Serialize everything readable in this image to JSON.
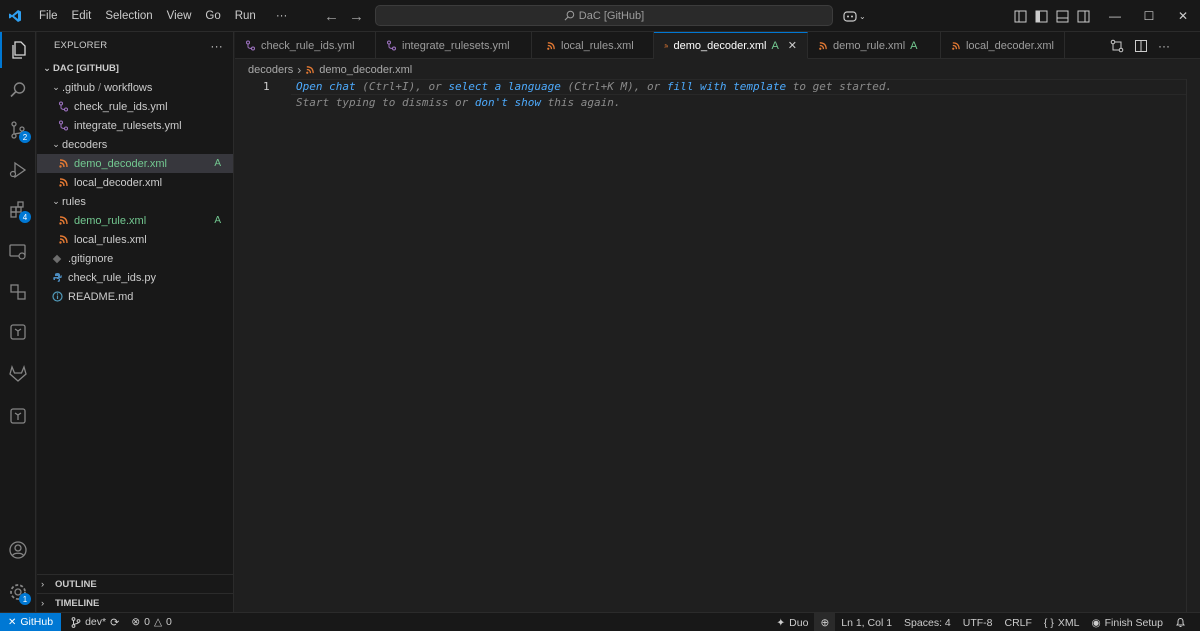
{
  "titlebar": {
    "menu": [
      "File",
      "Edit",
      "Selection",
      "View",
      "Go",
      "Run",
      "···"
    ],
    "command_center": "DaC [GitHub]"
  },
  "activity": {
    "scm_badge": "2",
    "extensions_badge": "4",
    "settings_badge": "1"
  },
  "sidebar": {
    "title": "EXPLORER",
    "more": "···",
    "root": "DAC [GITHUB]",
    "github_folder": ".github",
    "github_sub": "workflows",
    "check_rule_ids_yml": "check_rule_ids.yml",
    "integrate_rulesets_yml": "integrate_rulesets.yml",
    "decoders_folder": "decoders",
    "demo_decoder": "demo_decoder.xml",
    "demo_decoder_status": "A",
    "local_decoder": "local_decoder.xml",
    "rules_folder": "rules",
    "demo_rule": "demo_rule.xml",
    "demo_rule_status": "A",
    "local_rules": "local_rules.xml",
    "gitignore": ".gitignore",
    "check_rule_ids_py": "check_rule_ids.py",
    "readme": "README.md",
    "outline": "OUTLINE",
    "timeline": "TIMELINE"
  },
  "tabs": [
    {
      "label": "check_rule_ids.yml",
      "status": ""
    },
    {
      "label": "integrate_rulesets.yml",
      "status": ""
    },
    {
      "label": "local_rules.xml",
      "status": ""
    },
    {
      "label": "demo_decoder.xml",
      "status": "A"
    },
    {
      "label": "demo_rule.xml",
      "status": "A"
    },
    {
      "label": "local_decoder.xml",
      "status": ""
    }
  ],
  "breadcrumb": {
    "folder": "decoders",
    "file": "demo_decoder.xml"
  },
  "editor": {
    "line_number": "1",
    "open_chat": "Open chat",
    "open_chat_key": " (Ctrl+I), or ",
    "select_language": "select a language",
    "select_language_key": " (Ctrl+K M), or ",
    "fill_template": "fill with template",
    "hint_end": " to get started.",
    "start_typing": "Start typing to dismiss or ",
    "dont_show": "don't show",
    "hint2_end": " this again."
  },
  "statusbar": {
    "remote": "GitHub",
    "branch": "dev*",
    "errors": "0",
    "warnings": "0",
    "duo": "Duo",
    "position": "Ln 1, Col 1",
    "spaces": "Spaces: 4",
    "encoding": "UTF-8",
    "eol": "CRLF",
    "language": "XML",
    "finish_setup": "Finish Setup"
  },
  "colors": {
    "accent": "#0078d4",
    "git_added": "#73c991",
    "xml_icon": "#e37933",
    "link": "#4daafc"
  }
}
